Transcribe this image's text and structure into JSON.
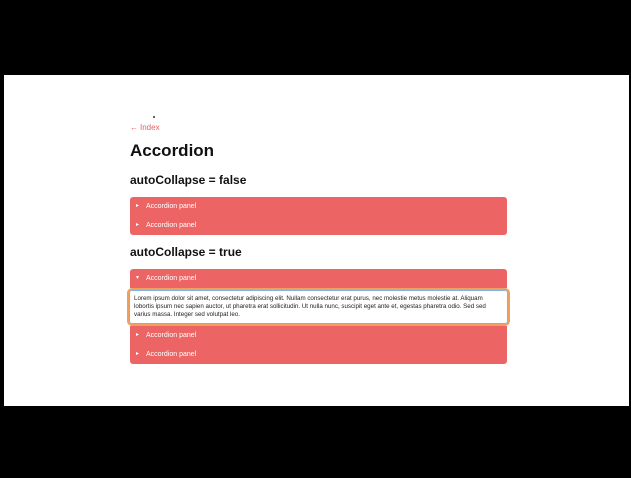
{
  "back_link": {
    "arrow": "←",
    "label": "Index"
  },
  "page_title": "Accordion",
  "sections": [
    {
      "title": "autoCollapse = false",
      "panels": [
        {
          "label": "Accordion panel",
          "expanded": false
        },
        {
          "label": "Accordion panel",
          "expanded": false
        }
      ]
    },
    {
      "title": "autoCollapse = true",
      "panels": [
        {
          "label": "Accordion panel",
          "expanded": true
        },
        {
          "label": "Accordion panel",
          "expanded": false
        },
        {
          "label": "Accordion panel",
          "expanded": false
        }
      ],
      "expanded_content": "Lorem ipsum dolor sit amet, consectetur adipiscing elit. Nullam consectetur erat purus, nec molestie metus molestie at. Aliquam lobortis ipsum nec sapien auctor, ut pharetra erat sollicitudin. Ut nulla nunc, suscipit eget ante et, egestas pharetra odio. Sed sed varius massa. Integer sed volutpat leo."
    }
  ],
  "icons": {
    "collapsed": "chevron-right-icon",
    "expanded": "chevron-down-icon"
  },
  "colors": {
    "panel": "#ed6464",
    "link": "#e56060",
    "focus_ring": "#f0a05a"
  }
}
